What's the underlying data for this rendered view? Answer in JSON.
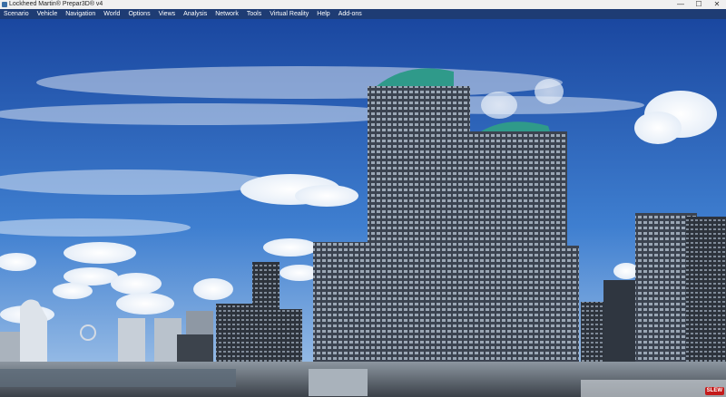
{
  "window": {
    "title": "Lockheed Martin® Prepar3D® v4",
    "controls": {
      "minimize": "—",
      "maximize": "☐",
      "close": "✕"
    }
  },
  "menu": {
    "items": [
      "Scenario",
      "Vehicle",
      "Navigation",
      "World",
      "Options",
      "Views",
      "Analysis",
      "Network",
      "Tools",
      "Virtual Reality",
      "Help",
      "Add-ons"
    ]
  },
  "viewport": {
    "scene": "city-skyline-view",
    "badge": "SLEW"
  },
  "colors": {
    "titlebar_bg": "#f0f0f0",
    "menubar_bg": "#1e3c74",
    "sky_top": "#1d4fa8",
    "sky_horizon": "#a9c8ea",
    "tower_roof": "#2f9a8a",
    "badge_bg": "#c41b1b"
  }
}
